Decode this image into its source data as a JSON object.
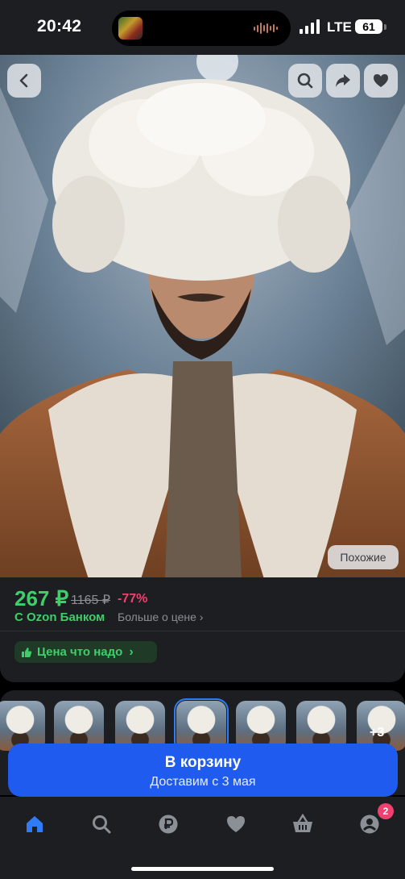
{
  "status_bar": {
    "time": "20:42",
    "network": "LTE",
    "battery": "61"
  },
  "product": {
    "price": "267 ₽",
    "old_price": "1165 ₽",
    "discount": "-77%",
    "bank_label": "С Ozon Банком",
    "more_price": "Больше о цене",
    "promo_label": "Цена что надо",
    "similar_label": "Похожие",
    "thumbnails_more": "+3"
  },
  "cart": {
    "title": "В корзину",
    "subtitle": "Доставим с 3 мая"
  },
  "nav": {
    "items": [
      "home-icon",
      "search-icon",
      "ruble-icon",
      "heart-icon",
      "basket-icon",
      "profile-icon"
    ],
    "profile_badge": "2",
    "active_color": "#2f7cf6"
  },
  "colors": {
    "price_green": "#3ecf6a",
    "discount_pink": "#f0416e",
    "primary_blue": "#1f5bef"
  }
}
